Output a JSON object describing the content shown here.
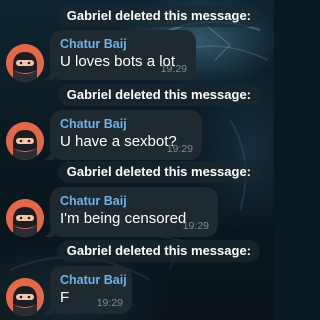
{
  "service_messages": [
    "Gabriel deleted this message:",
    "Gabriel deleted this message:",
    "Gabriel deleted this message:",
    "Gabriel deleted this message:"
  ],
  "messages": [
    {
      "sender": "Chatur Baij",
      "text": "U loves bots a lot",
      "time": "19:29"
    },
    {
      "sender": "Chatur Baij",
      "text": "U have a sexbot?",
      "time": "19:29"
    },
    {
      "sender": "Chatur Baij",
      "text": "I'm being censored",
      "time": "19:29"
    },
    {
      "sender": "Chatur Baij",
      "text": "F",
      "time": "19:29"
    }
  ],
  "colors": {
    "sender_name": "#6fb2e8",
    "bubble": "#1f2a30",
    "avatar_bg": "#e3684a",
    "service_pill": "#19282f"
  },
  "icons": {
    "avatar": "ninja-avatar-icon"
  }
}
